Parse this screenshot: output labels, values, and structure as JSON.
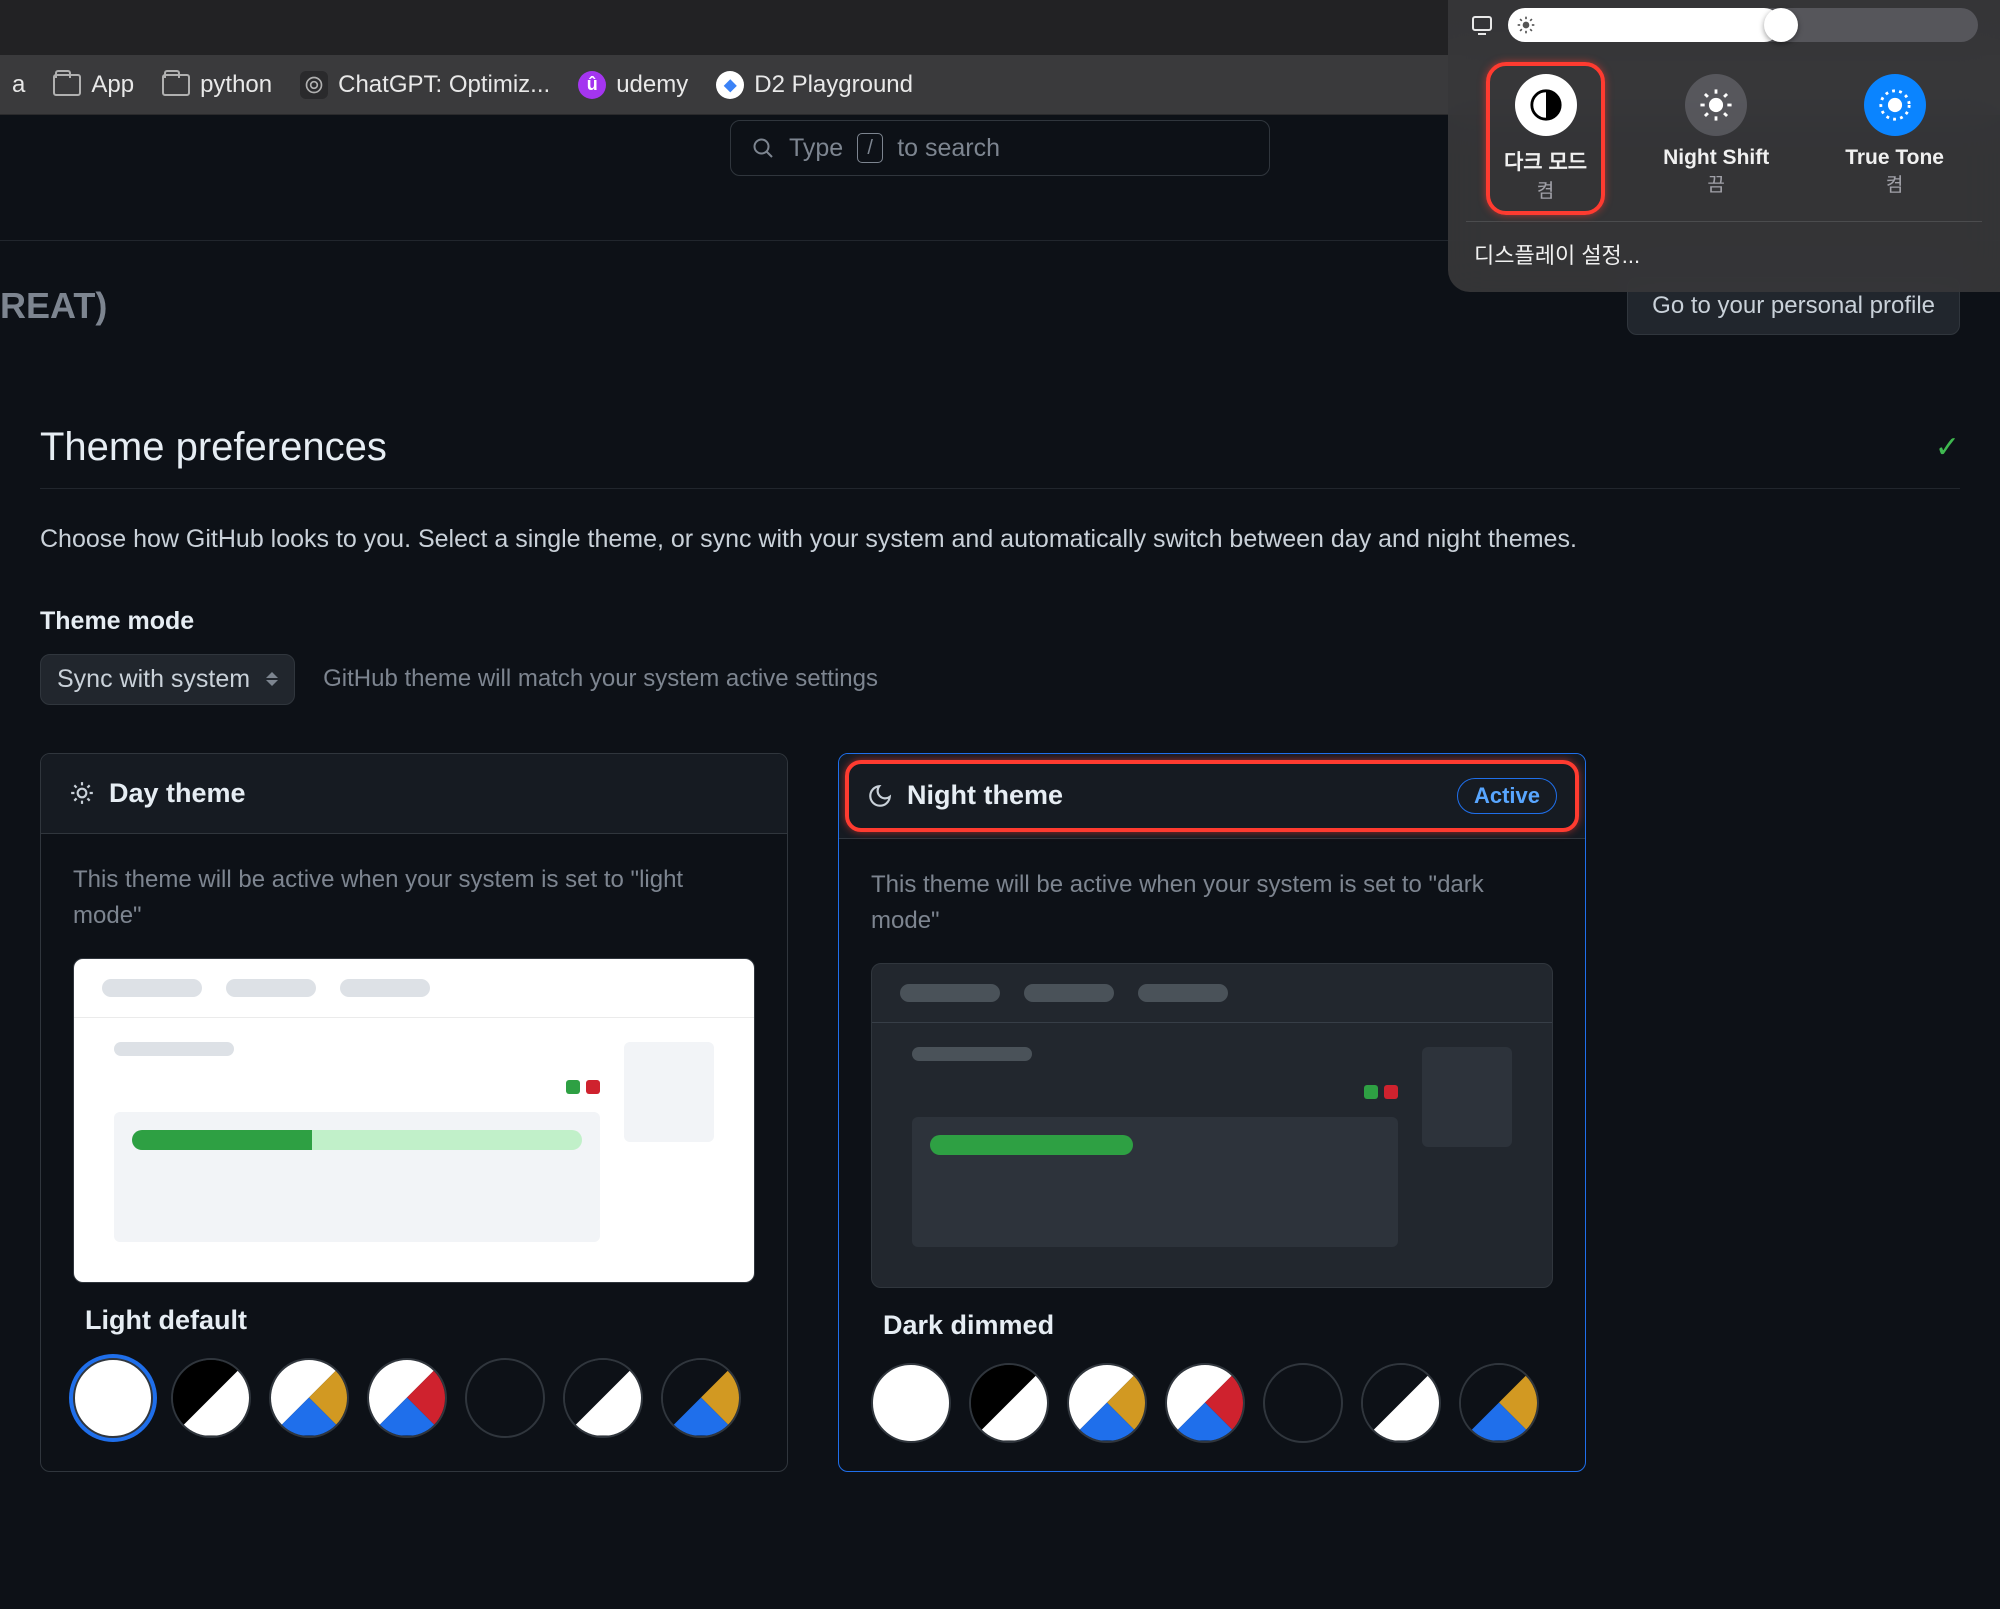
{
  "bookmarks": {
    "folder_app": "App",
    "folder_python": "python",
    "chatgpt": "ChatGPT: Optimiz...",
    "udemy": "udemy",
    "d2": "D2 Playground",
    "partial_left": "a"
  },
  "control_center": {
    "dark_mode": {
      "label": "다크 모드",
      "sub": "켬"
    },
    "night_shift": {
      "label": "Night Shift",
      "sub": "끔"
    },
    "true_tone": {
      "label": "True Tone",
      "sub": "켬"
    },
    "display_settings": "디스플레이 설정..."
  },
  "search": {
    "prefix": "Type",
    "key": "/",
    "suffix": "to search"
  },
  "header": {
    "partial_title": "REAT)",
    "profile_button": "Go to your personal profile"
  },
  "section": {
    "title": "Theme preferences",
    "description": "Choose how GitHub looks to you. Select a single theme, or sync with your system and automatically switch between day and night themes."
  },
  "theme_mode": {
    "label": "Theme mode",
    "select_value": "Sync with system",
    "hint": "GitHub theme will match your system active settings"
  },
  "day_card": {
    "header": "Day theme",
    "description": "This theme will be active when your system is set to \"light mode\"",
    "theme_name": "Light default"
  },
  "night_card": {
    "header": "Night theme",
    "badge": "Active",
    "description": "This theme will be active when your system is set to \"dark mode\"",
    "theme_name": "Dark dimmed"
  }
}
